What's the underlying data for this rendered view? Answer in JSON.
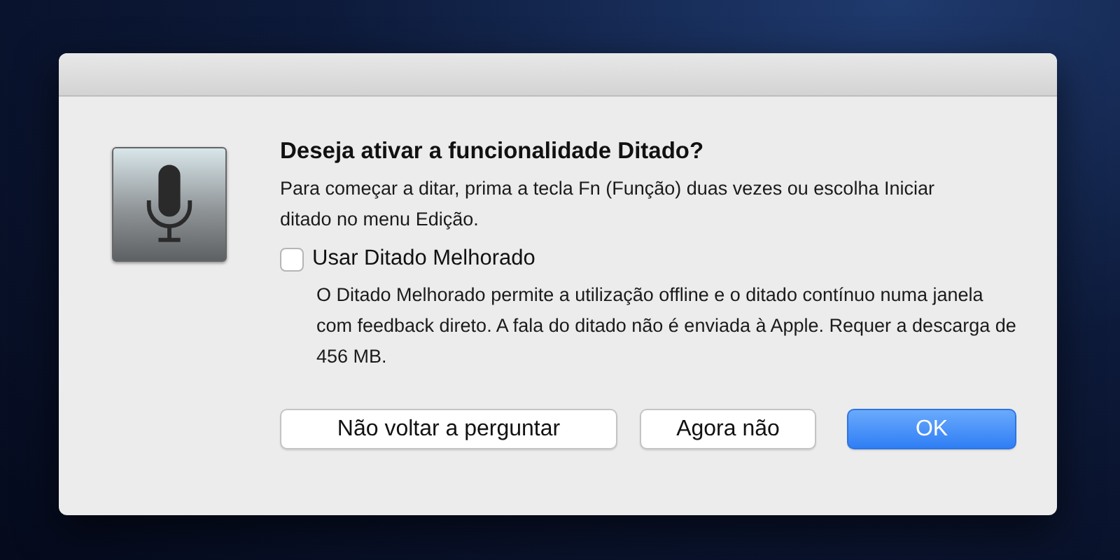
{
  "dialog": {
    "title": "Deseja ativar a funcionalidade Ditado?",
    "message": "Para começar a ditar, prima a tecla Fn (Função) duas vezes ou escolha Iniciar ditado no menu Edição.",
    "checkbox": {
      "label": "Usar Ditado Melhorado",
      "checked": false
    },
    "description": "O Ditado Melhorado permite a utilização offline e o ditado contínuo numa janela com feedback direto. A fala do ditado não é enviada à Apple. Requer a descarga de 456 MB.",
    "buttons": [
      {
        "label": "Não voltar a perguntar",
        "primary": false
      },
      {
        "label": "Agora não",
        "primary": false
      },
      {
        "label": "OK",
        "primary": true
      }
    ]
  }
}
